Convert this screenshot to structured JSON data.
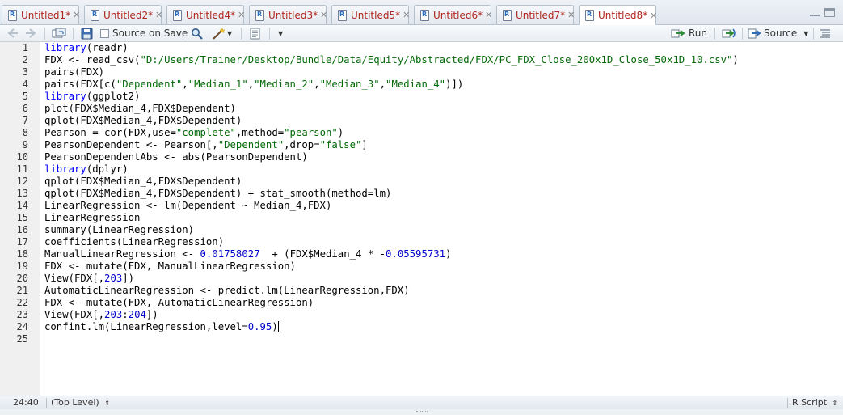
{
  "tabs": [
    {
      "label": "Untitled1*"
    },
    {
      "label": "Untitled2*"
    },
    {
      "label": "Untitled4*"
    },
    {
      "label": "Untitled3*"
    },
    {
      "label": "Untitled5*"
    },
    {
      "label": "Untitled6*"
    },
    {
      "label": "Untitled7*"
    },
    {
      "label": "Untitled8*",
      "active": true
    }
  ],
  "toolbar": {
    "source_on_save_label": "Source on Save",
    "source_on_save_checked": false,
    "run_label": "Run",
    "source_label": "Source"
  },
  "editor": {
    "lines": [
      {
        "n": "1",
        "tokens": [
          [
            "kw",
            "library"
          ],
          [
            "",
            "(readr)"
          ]
        ]
      },
      {
        "n": "2",
        "tokens": [
          [
            "",
            "FDX <- read_csv("
          ],
          [
            "str",
            "\"D:/Users/Trainer/Desktop/Bundle/Data/Equity/Abstracted/FDX/PC_FDX_Close_200x1D_Close_50x1D_10.csv\""
          ],
          [
            "",
            ")"
          ]
        ]
      },
      {
        "n": "3",
        "tokens": [
          [
            "",
            "pairs(FDX)"
          ]
        ]
      },
      {
        "n": "4",
        "tokens": [
          [
            "",
            "pairs(FDX[c("
          ],
          [
            "str",
            "\"Dependent\""
          ],
          [
            "",
            ","
          ],
          [
            "str",
            "\"Median_1\""
          ],
          [
            "",
            ","
          ],
          [
            "str",
            "\"Median_2\""
          ],
          [
            "",
            ","
          ],
          [
            "str",
            "\"Median_3\""
          ],
          [
            "",
            ","
          ],
          [
            "str",
            "\"Median_4\""
          ],
          [
            "",
            ")])"
          ]
        ]
      },
      {
        "n": "5",
        "tokens": [
          [
            "kw",
            "library"
          ],
          [
            "",
            "(ggplot2)"
          ]
        ]
      },
      {
        "n": "6",
        "tokens": [
          [
            "",
            "plot(FDX$Median_4,FDX$Dependent)"
          ]
        ]
      },
      {
        "n": "7",
        "tokens": [
          [
            "",
            "qplot(FDX$Median_4,FDX$Dependent)"
          ]
        ]
      },
      {
        "n": "8",
        "tokens": [
          [
            "",
            "Pearson = cor(FDX,use="
          ],
          [
            "str",
            "\"complete\""
          ],
          [
            "",
            ",method="
          ],
          [
            "str",
            "\"pearson\""
          ],
          [
            "",
            ")"
          ]
        ]
      },
      {
        "n": "9",
        "tokens": [
          [
            "",
            "PearsonDependent <- Pearson[,"
          ],
          [
            "str",
            "\"Dependent\""
          ],
          [
            "",
            ",drop="
          ],
          [
            "str",
            "\"false\""
          ],
          [
            "",
            "]"
          ]
        ]
      },
      {
        "n": "10",
        "tokens": [
          [
            "",
            "PearsonDependentAbs <- abs(PearsonDependent)"
          ]
        ]
      },
      {
        "n": "11",
        "tokens": [
          [
            "kw",
            "library"
          ],
          [
            "",
            "(dplyr)"
          ]
        ]
      },
      {
        "n": "12",
        "tokens": [
          [
            "",
            "qplot(FDX$Median_4,FDX$Dependent)"
          ]
        ]
      },
      {
        "n": "13",
        "tokens": [
          [
            "",
            "qplot(FDX$Median_4,FDX$Dependent) + stat_smooth(method=lm)"
          ]
        ]
      },
      {
        "n": "14",
        "tokens": [
          [
            "",
            "LinearRegression <- lm(Dependent ~ Median_4,FDX)"
          ]
        ]
      },
      {
        "n": "15",
        "tokens": [
          [
            "",
            "LinearRegression"
          ]
        ]
      },
      {
        "n": "16",
        "tokens": [
          [
            "",
            "summary(LinearRegression)"
          ]
        ]
      },
      {
        "n": "17",
        "tokens": [
          [
            "",
            "coefficients(LinearRegression)"
          ]
        ]
      },
      {
        "n": "18",
        "tokens": [
          [
            "",
            "ManualLinearRegression <- "
          ],
          [
            "num",
            "0.01758027"
          ],
          [
            "",
            "  + (FDX$Median_4 * -"
          ],
          [
            "num",
            "0.05595731"
          ],
          [
            "",
            ")"
          ]
        ]
      },
      {
        "n": "19",
        "tokens": [
          [
            "",
            "FDX <- mutate(FDX, ManualLinearRegression)"
          ]
        ]
      },
      {
        "n": "20",
        "tokens": [
          [
            "",
            "View(FDX[,"
          ],
          [
            "num",
            "203"
          ],
          [
            "",
            "])"
          ]
        ]
      },
      {
        "n": "21",
        "tokens": [
          [
            "",
            "AutomaticLinearRegression <- predict.lm(LinearRegression,FDX)"
          ]
        ]
      },
      {
        "n": "22",
        "tokens": [
          [
            "",
            "FDX <- mutate(FDX, AutomaticLinearRegression)"
          ]
        ]
      },
      {
        "n": "23",
        "tokens": [
          [
            "",
            "View(FDX[,"
          ],
          [
            "num",
            "203"
          ],
          [
            "",
            ":"
          ],
          [
            "num",
            "204"
          ],
          [
            "",
            "])"
          ]
        ]
      },
      {
        "n": "24",
        "tokens": [
          [
            "",
            "confint.lm(LinearRegression,level="
          ],
          [
            "num",
            "0.95"
          ],
          [
            "",
            ")"
          ]
        ],
        "cursor": true
      },
      {
        "n": "25",
        "tokens": []
      }
    ]
  },
  "statusbar": {
    "position": "24:40",
    "scope": "(Top Level)",
    "filetype": "R Script"
  },
  "colors": {
    "tab_text": "#b0261e",
    "keyword": "#0000ff",
    "string": "#036a07",
    "number": "#0000cd"
  },
  "icons": [
    "back-arrow-icon",
    "forward-arrow-icon",
    "show-in-window-icon",
    "save-icon",
    "search-icon",
    "magic-wand-icon",
    "compile-notebook-icon",
    "run-icon",
    "rerun-icon",
    "source-icon",
    "outline-icon",
    "chevron-down-icon",
    "close-icon"
  ]
}
